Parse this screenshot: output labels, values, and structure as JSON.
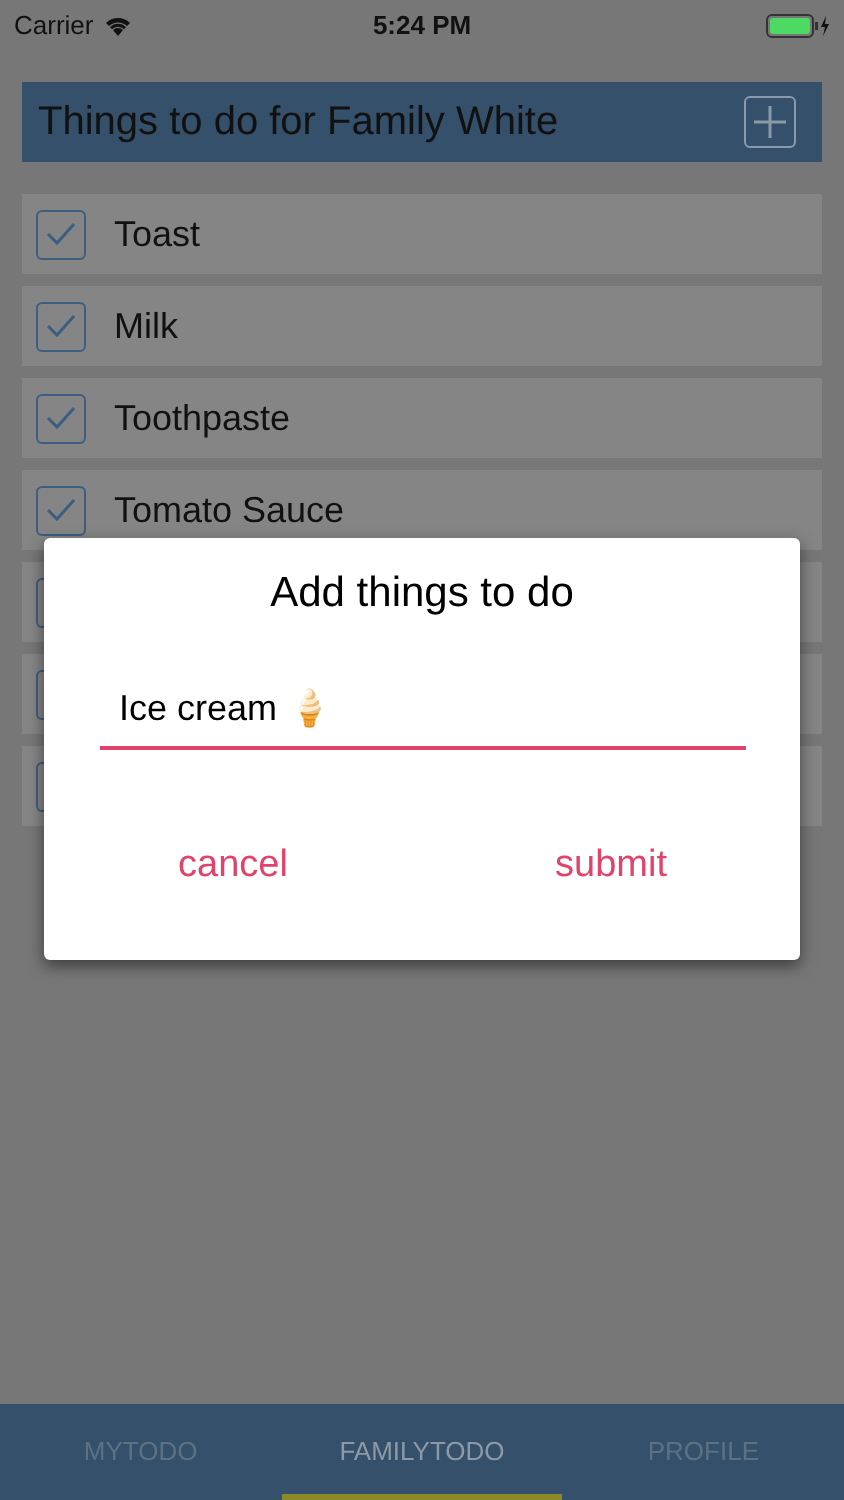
{
  "status_bar": {
    "carrier": "Carrier",
    "time": "5:24 PM"
  },
  "header": {
    "title": "Things to do for Family White"
  },
  "items": [
    {
      "kind": "todo",
      "label": "Toast",
      "checked": true
    },
    {
      "kind": "todo",
      "label": "Milk",
      "checked": true
    },
    {
      "kind": "todo",
      "label": "Toothpaste",
      "checked": true
    },
    {
      "kind": "todo",
      "label": "Tomato Sauce",
      "checked": true
    },
    {
      "kind": "covered"
    },
    {
      "kind": "covered"
    },
    {
      "kind": "covered"
    }
  ],
  "dialog": {
    "title": "Add things to do",
    "value": "Ice cream 🍦",
    "buttons": [
      "cancel",
      "submit"
    ]
  },
  "tabs": [
    {
      "label": "MYTODO",
      "selected": false
    },
    {
      "label": "FAMILYTODO",
      "selected": true
    },
    {
      "label": "PROFILE",
      "selected": false
    }
  ]
}
